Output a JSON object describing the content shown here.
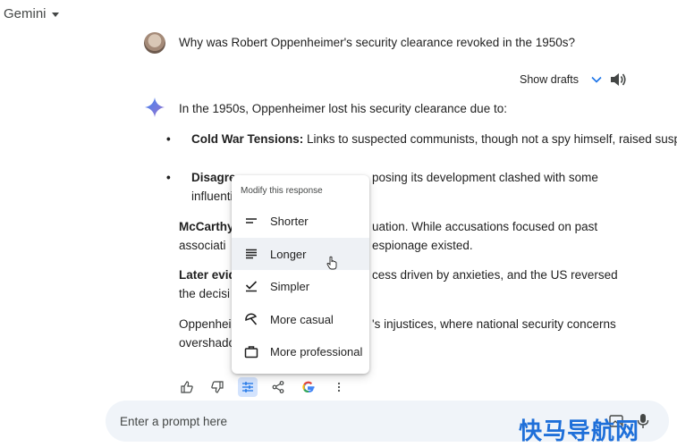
{
  "app": {
    "name": "Gemini"
  },
  "user_query": "Why was Robert Oppenheimer's security clearance revoked in the 1950s?",
  "drafts": {
    "label": "Show drafts"
  },
  "response": {
    "intro": "In the 1950s, Oppenheimer lost his security clearance due to:",
    "bullets": [
      {
        "bold": "Cold War Tensions:",
        "text": " Links to suspected communists, though not a spy himself, raised suspicion."
      },
      {
        "bold": "Disagre",
        "text_right": "posing its development clashed with some",
        "text_line2": "influenti"
      }
    ],
    "p_mccarthy": {
      "bold": "McCarthy",
      "text_right": "uation. While accusations focused on past",
      "line2_left": "associati",
      "line2_right": "espionage existed."
    },
    "p_later": {
      "bold": "Later evid",
      "text_right": "cess driven by anxieties, and the US reversed",
      "line2_left": "the decisi"
    },
    "p_oppen": {
      "left": "Oppenheir",
      "text_right": "'s injustices, where national security concerns",
      "line2_left": "overshado"
    }
  },
  "modify_menu": {
    "title": "Modify this response",
    "items": [
      {
        "label": "Shorter",
        "icon": "shorter-icon"
      },
      {
        "label": "Longer",
        "icon": "longer-icon"
      },
      {
        "label": "Simpler",
        "icon": "simpler-icon"
      },
      {
        "label": "More casual",
        "icon": "casual-icon"
      },
      {
        "label": "More professional",
        "icon": "briefcase-icon"
      }
    ]
  },
  "prompt": {
    "placeholder": "Enter a prompt here"
  },
  "watermark": "快马导航网",
  "colors": {
    "accent": "#1a73e8",
    "prompt_bg": "#f0f4f9",
    "highlight": "#d3e3fd"
  }
}
